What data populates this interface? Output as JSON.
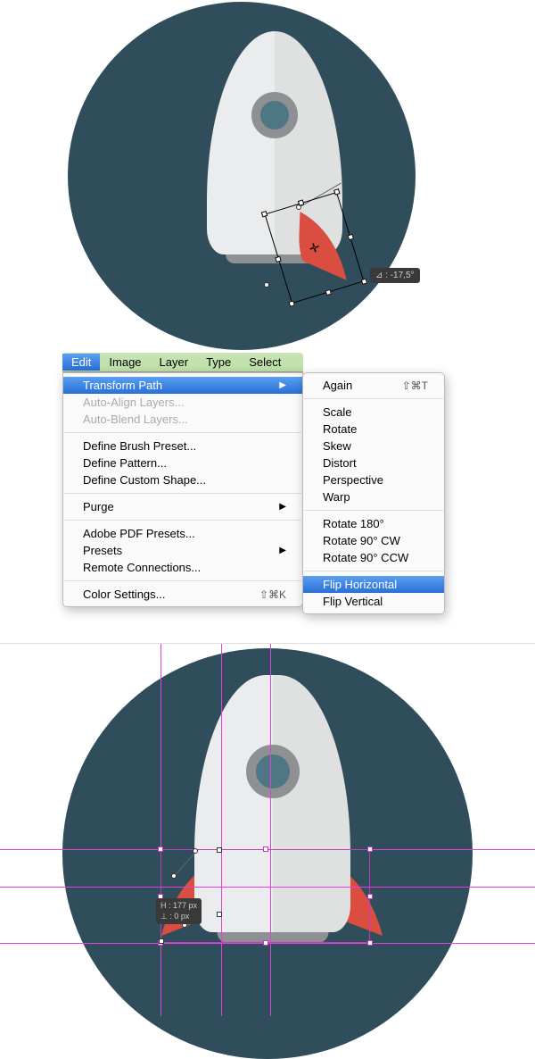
{
  "tooltip_angle": "⊿ : -17,5°",
  "tooltip_measure_h": "H : 177 px",
  "tooltip_measure_d": "⊥ : 0 px",
  "menubar": {
    "edit": "Edit",
    "image": "Image",
    "layer": "Layer",
    "type": "Type",
    "select": "Select"
  },
  "menu": {
    "transform_path": "Transform Path",
    "auto_align": "Auto-Align Layers...",
    "auto_blend": "Auto-Blend Layers...",
    "define_brush": "Define Brush Preset...",
    "define_pattern": "Define Pattern...",
    "define_shape": "Define Custom Shape...",
    "purge": "Purge",
    "pdf_presets": "Adobe PDF Presets...",
    "presets": "Presets",
    "remote": "Remote Connections...",
    "color_settings": "Color Settings...",
    "color_settings_shortcut": "⇧⌘K"
  },
  "submenu": {
    "again": "Again",
    "again_shortcut": "⇧⌘T",
    "scale": "Scale",
    "rotate": "Rotate",
    "skew": "Skew",
    "distort": "Distort",
    "perspective": "Perspective",
    "warp": "Warp",
    "rotate180": "Rotate 180°",
    "rotate90cw": "Rotate 90° CW",
    "rotate90ccw": "Rotate 90° CCW",
    "flip_h": "Flip Horizontal",
    "flip_v": "Flip Vertical"
  }
}
